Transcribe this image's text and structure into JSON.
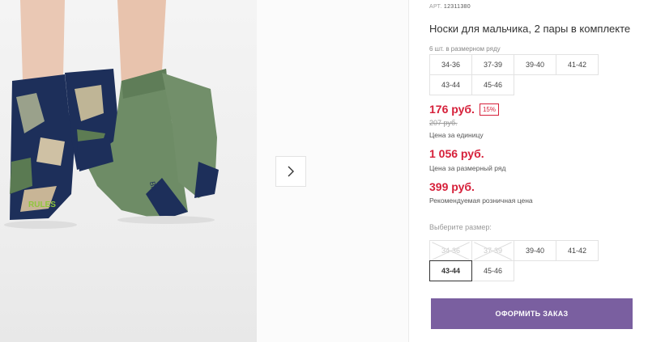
{
  "product": {
    "article_label": "АРТ.",
    "article_number": "12311380",
    "title": "Носки для мальчика, 2 пары в комплекте",
    "in_set_text": "6 шт. в размерном ряду",
    "set_sizes": [
      "34-36",
      "37-39",
      "39-40",
      "41-42",
      "43-44",
      "45-46"
    ]
  },
  "pricing": {
    "price": "176 руб.",
    "discount": "15%",
    "old_price": "207 руб.",
    "unit_label": "Цена за единицу",
    "set_price": "1 056 руб.",
    "set_label": "Цена за размерный ряд",
    "rrp": "399 руб.",
    "rrp_label": "Рекомендуемая розничная цена"
  },
  "size_picker": {
    "label": "Выберите размер:",
    "options": [
      {
        "label": "34-36",
        "available": false,
        "selected": false
      },
      {
        "label": "37-39",
        "available": false,
        "selected": false
      },
      {
        "label": "39-40",
        "available": true,
        "selected": false
      },
      {
        "label": "41-42",
        "available": true,
        "selected": false
      },
      {
        "label": "43-44",
        "available": true,
        "selected": true
      },
      {
        "label": "45-46",
        "available": true,
        "selected": false
      }
    ]
  },
  "actions": {
    "order_label": "ОФОРМИТЬ ЗАКАЗ",
    "next_icon": "chevron-right-icon"
  },
  "photo": {
    "sock_text_left": "RULES",
    "sock_text_right": "BR"
  },
  "colors": {
    "accent": "#7a5fa0",
    "price": "#d6203a"
  }
}
